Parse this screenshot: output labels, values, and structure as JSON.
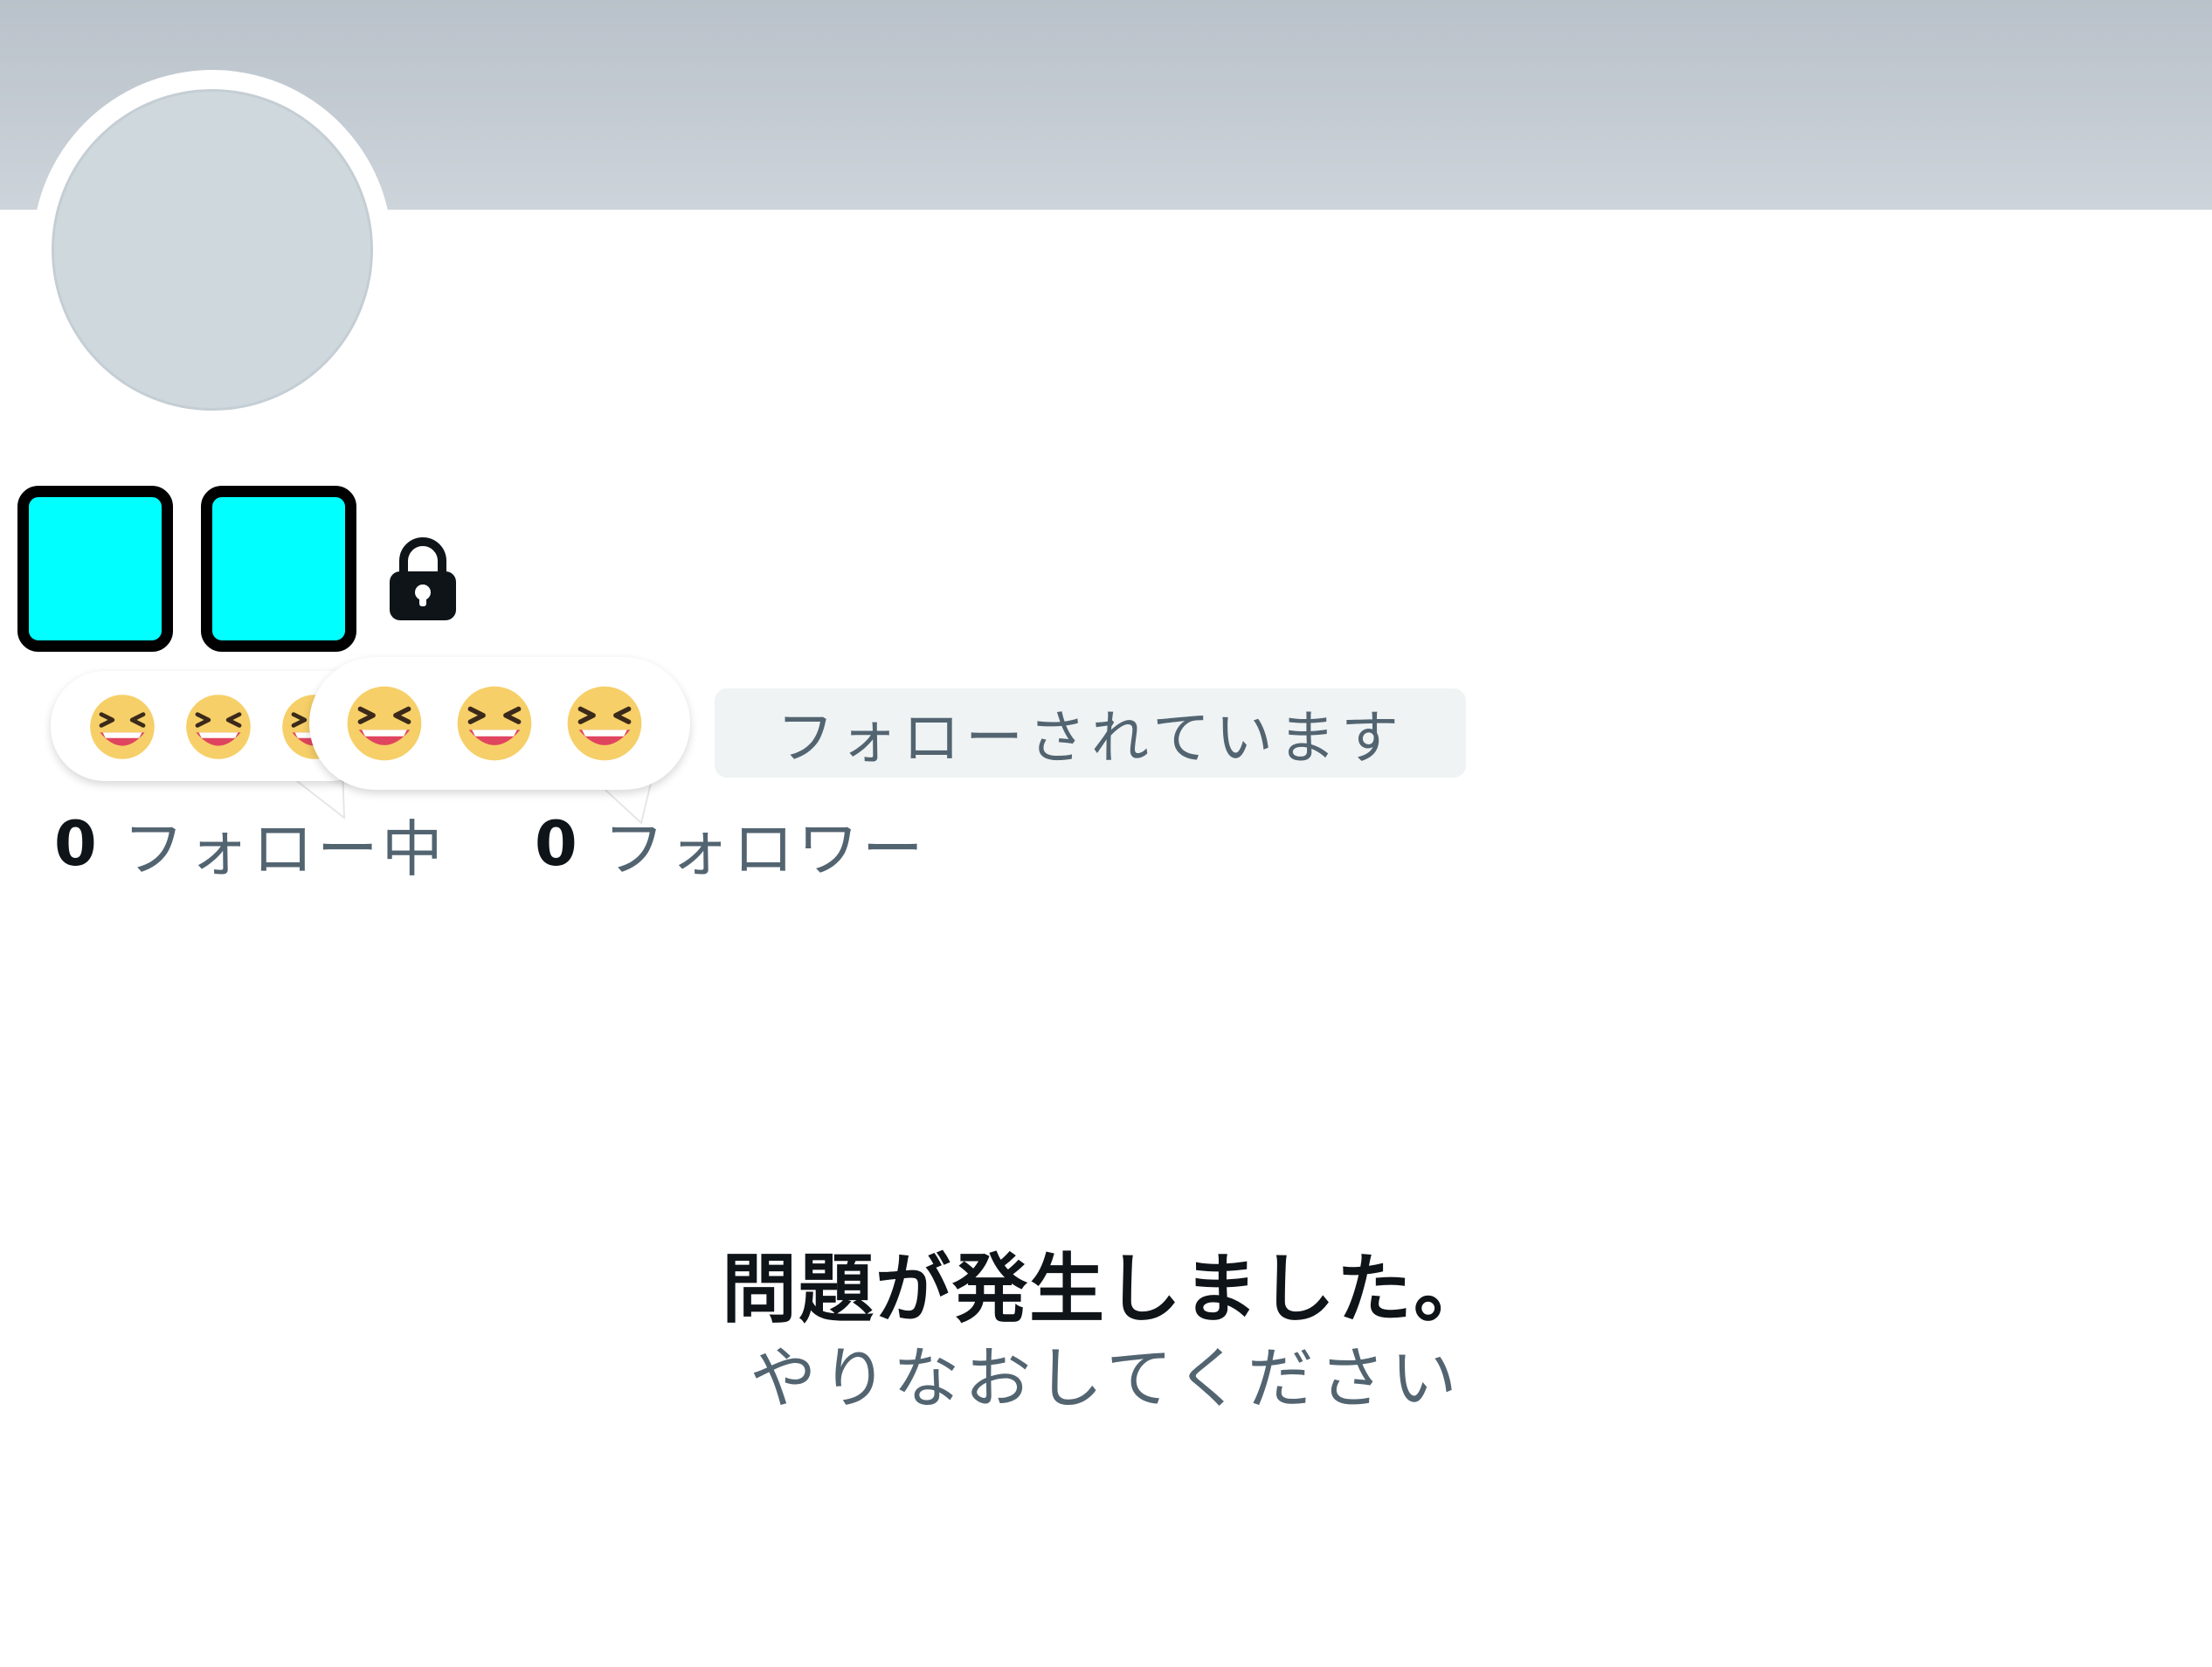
{
  "profile": {
    "protected_icon": "lock-icon",
    "follows_you_badge": "フォローされています",
    "following": {
      "count": "0",
      "label": "フォロー中"
    },
    "followers": {
      "count": "0",
      "label": "フォロワー"
    },
    "reaction_emoji": "laughing-face-emoji"
  },
  "error": {
    "title": "問題が発生しました。",
    "subtitle": "やりなおしてください"
  },
  "colors": {
    "banner": "#c4ccd3",
    "avatar_placeholder": "#cfd8dd",
    "redaction_fill": "#00ffff",
    "badge_bg": "#eff3f4",
    "primary_text": "#0f1419",
    "secondary_text": "#536471"
  }
}
